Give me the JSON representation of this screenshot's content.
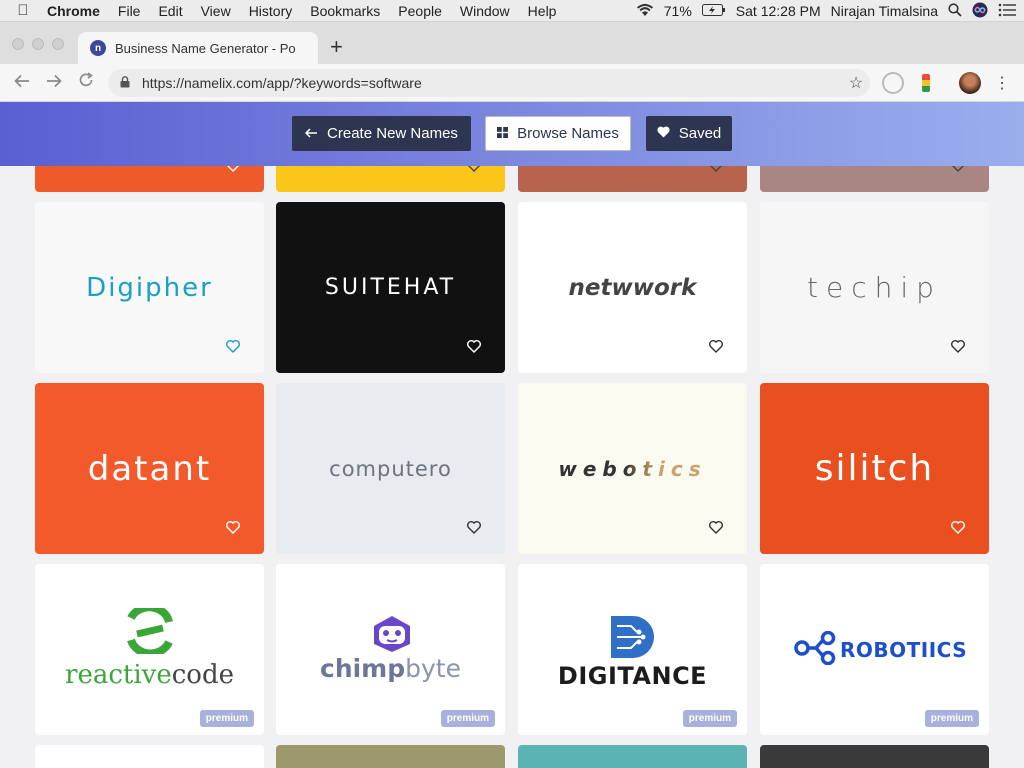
{
  "menubar": {
    "app": "Chrome",
    "items": [
      "File",
      "Edit",
      "View",
      "History",
      "Bookmarks",
      "People",
      "Window",
      "Help"
    ],
    "battery": "71%",
    "clock": "Sat 12:28 PM",
    "user": "Nirajan Timalsina"
  },
  "tab": {
    "title": "Business Name Generator - Po",
    "favicon_letter": "n"
  },
  "toolbar": {
    "url": "https://namelix.com/app/?keywords=software"
  },
  "header": {
    "create_label": "Create New Names",
    "browse_label": "Browse Names",
    "saved_label": "Saved"
  },
  "cards_top_partial": [
    {
      "color": "#ee5a2a"
    },
    {
      "color": "#fbc61a"
    },
    {
      "color": "#b8634e"
    },
    {
      "color": "#a98684"
    }
  ],
  "cards_row1": [
    {
      "name": "Digipher",
      "bg": "#f8f8f8",
      "fg": "#1aa0c6",
      "heart": "#1aa0c6"
    },
    {
      "name": "SUITEHAT",
      "bg": "#111111",
      "fg": "#ffffff",
      "heart": "#ffffff"
    },
    {
      "name": "netwwork",
      "bg": "#ffffff",
      "fg": "#444444",
      "heart": "#333333"
    },
    {
      "name": "techip",
      "bg": "#f6f6f6",
      "fg": "#555555",
      "heart": "#333333"
    }
  ],
  "cards_row2": [
    {
      "name": "datant",
      "bg": "#f25a2c",
      "fg": "#ffffff",
      "heart": "#ffffff"
    },
    {
      "name": "computero",
      "bg": "#e8ebef",
      "fg": "#6b7480",
      "heart": "#333333"
    },
    {
      "name": "webotics",
      "bg": "#fbfaf0",
      "fg": "#333333",
      "heart": "#333333"
    },
    {
      "name": "silitch",
      "bg": "#e94f1f",
      "fg": "#ffffff",
      "heart": "#ffffff"
    }
  ],
  "cards_row3": [
    {
      "name_a": "reactive",
      "name_b": "code",
      "badge": "premium"
    },
    {
      "name_a": "chimp",
      "name_b": "byte",
      "badge": "premium"
    },
    {
      "name": "DIGITANCE",
      "badge": "premium"
    },
    {
      "name": "ROBOTIICS",
      "badge": "premium"
    }
  ],
  "cards_bottom_partial": [
    {
      "color": "#ffffff"
    },
    {
      "color": "#9c9a6c"
    },
    {
      "color": "#5bb4b3"
    },
    {
      "color": "#3a3a3a"
    }
  ]
}
